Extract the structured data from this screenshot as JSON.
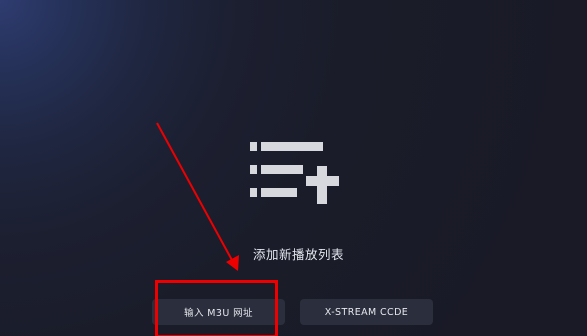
{
  "screen": {
    "title": "添加新播放列表",
    "buttons": {
      "m3u_label": "输入 M3U 网址",
      "xstream_label": "X-STREAM CCDE"
    },
    "icon": "playlist-add-icon"
  },
  "annotation": {
    "color": "#ee0000"
  }
}
